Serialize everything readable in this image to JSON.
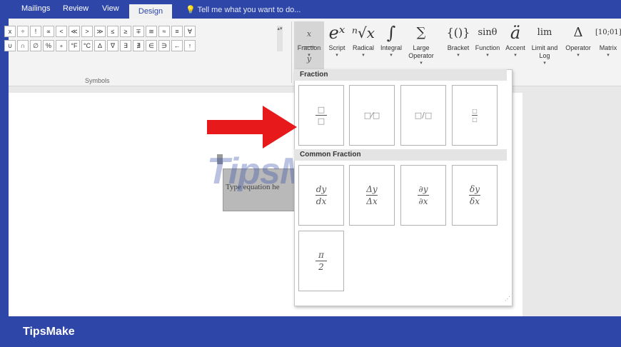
{
  "tabs": {
    "mailings": "Mailings",
    "review": "Review",
    "view": "View",
    "design": "Design",
    "tell_me": "Tell me what you want to do..."
  },
  "symbols": {
    "row1": [
      "÷",
      "!",
      "∝",
      "<",
      "≪",
      ">",
      "≫",
      "≤",
      "≥",
      "∓",
      "≅",
      "≈",
      "≡",
      "∀"
    ],
    "row2": [
      "∩",
      "∅",
      "%",
      "∘",
      "°F",
      "°C",
      "∆",
      "∇",
      "∃",
      "∄",
      "∈",
      "∋",
      "←",
      "↑"
    ],
    "group_label": "Symbols"
  },
  "ribbon": {
    "fraction": {
      "glyph": "x/y",
      "label": "Fraction"
    },
    "script": {
      "glyph": "eˣ",
      "label": "Script"
    },
    "radical": {
      "glyph": "ⁿ√x",
      "label": "Radical"
    },
    "integral": {
      "glyph": "∫",
      "label": "Integral"
    },
    "large_operator": {
      "glyph": "∑",
      "label": "Large Operator"
    },
    "bracket": {
      "glyph": "{()}",
      "label": "Bracket"
    },
    "function": {
      "glyph": "sinθ",
      "label": "Function"
    },
    "accent": {
      "glyph": "ä",
      "label": "Accent"
    },
    "limit": {
      "glyph": "lim",
      "label": "Limit and Log"
    },
    "operator": {
      "glyph": "Δ",
      "label": "Operator"
    },
    "matrix": {
      "glyph": "[10;01]",
      "label": "Matrix"
    }
  },
  "dropdown": {
    "section1": "Fraction",
    "section2": "Common Fraction",
    "common": [
      {
        "num": "dy",
        "den": "dx"
      },
      {
        "num": "Δy",
        "den": "Δx"
      },
      {
        "num": "∂y",
        "den": "∂x"
      },
      {
        "num": "δy",
        "den": "δx"
      },
      {
        "num": "π",
        "den": "2"
      }
    ]
  },
  "document": {
    "equation_placeholder": "Type equation he",
    "watermark": "TipsMake"
  },
  "footer": {
    "brand": "TipsMake"
  },
  "colors": {
    "brand": "#2e46a8",
    "arrow": "#e8191b"
  }
}
